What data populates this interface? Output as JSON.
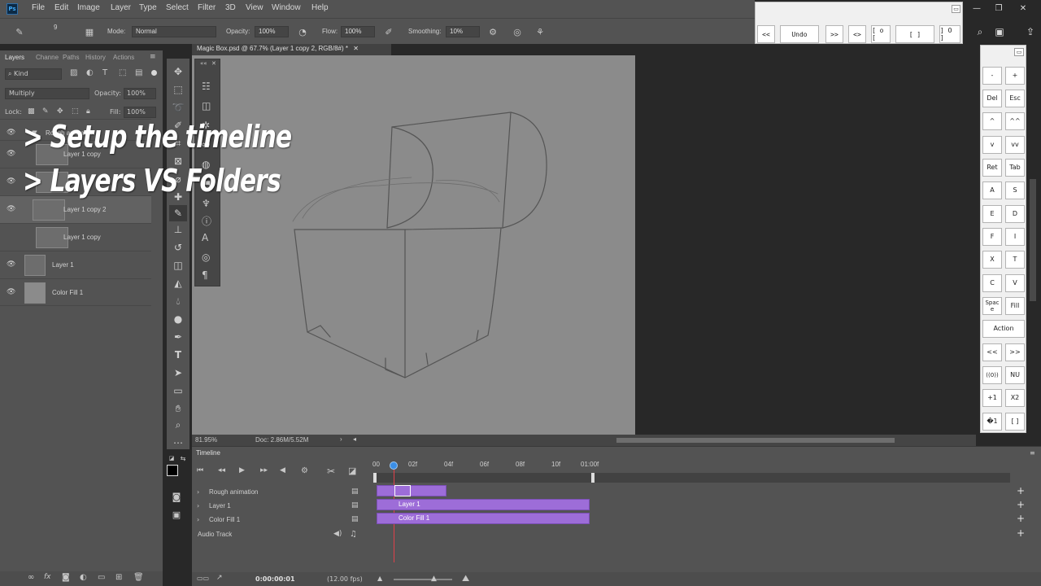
{
  "menu": [
    "File",
    "Edit",
    "Image",
    "Layer",
    "Type",
    "Select",
    "Filter",
    "3D",
    "View",
    "Window",
    "Help"
  ],
  "app_icon_label": "Ps",
  "options": {
    "mode_label": "Mode:",
    "mode_value": "Normal",
    "opacity_label": "Opacity:",
    "opacity_value": "100%",
    "flow_label": "Flow:",
    "flow_value": "100%",
    "smoothing_label": "Smoothing:",
    "smoothing_value": "10%",
    "brush_size": "9"
  },
  "undo_toolbar": [
    "<<",
    "Undo",
    ">>",
    "<>",
    "[ o [",
    "[ ]",
    "] O ]"
  ],
  "layers_panel": {
    "tabs": [
      "Layers",
      "Channe",
      "Paths",
      "History",
      "Actions"
    ],
    "filter_kind": "Kind",
    "blend_mode": "Multiply",
    "opacity_label": "Opacity:",
    "opacity_value": "100%",
    "lock_label": "Lock:",
    "fill_label": "Fill:",
    "fill_value": "100%",
    "layers": [
      {
        "name": "Rough animation"
      },
      {
        "name": "Layer 1 copy"
      },
      {
        "name": ""
      },
      {
        "name": "Layer 1 copy 2"
      },
      {
        "name": "Layer 1 copy"
      },
      {
        "name": "Layer 1"
      },
      {
        "name": "Color Fill 1"
      }
    ]
  },
  "document": {
    "tab_title": "Magic Box.psd @ 67.7% (Layer 1 copy 2, RGB/8#) *",
    "zoom": "81.95%",
    "doc_size": "Doc: 2.86M/5.52M"
  },
  "keypad": [
    [
      "-",
      "+"
    ],
    [
      "Del",
      "Esc"
    ],
    [
      "^",
      "^^"
    ],
    [
      "v",
      "vv"
    ],
    [
      "Ret",
      "Tab"
    ],
    [
      "A",
      "S"
    ],
    [
      "E",
      "D"
    ],
    [
      "F",
      "I"
    ],
    [
      "X",
      "T"
    ],
    [
      "C",
      "V"
    ],
    [
      "Spac e",
      "Fill"
    ],
    [
      "Action"
    ],
    [
      "<<",
      ">>"
    ],
    [
      "((0))",
      "NU"
    ],
    [
      "+1",
      "X2"
    ],
    [
      "�1",
      "[ ]"
    ]
  ],
  "timeline": {
    "title": "Timeline",
    "ruler": [
      "00",
      "02f",
      "04f",
      "06f",
      "08f",
      "10f",
      "01:00f"
    ],
    "tracks": [
      "Rough animation",
      "Layer 1",
      "Color Fill 1",
      "Audio Track"
    ],
    "clips": [
      "Layer 1",
      "Color Fill 1"
    ],
    "timecode": "0:00:00:01",
    "fps": "(12.00 fps)"
  },
  "captions": [
    "> Setup the timeline",
    "> Layers VS Folders"
  ],
  "colors": {
    "clip": "#9d6dd8",
    "canvas": "#8b8b8b",
    "panel": "#535353",
    "playhead": "#e0404a"
  }
}
